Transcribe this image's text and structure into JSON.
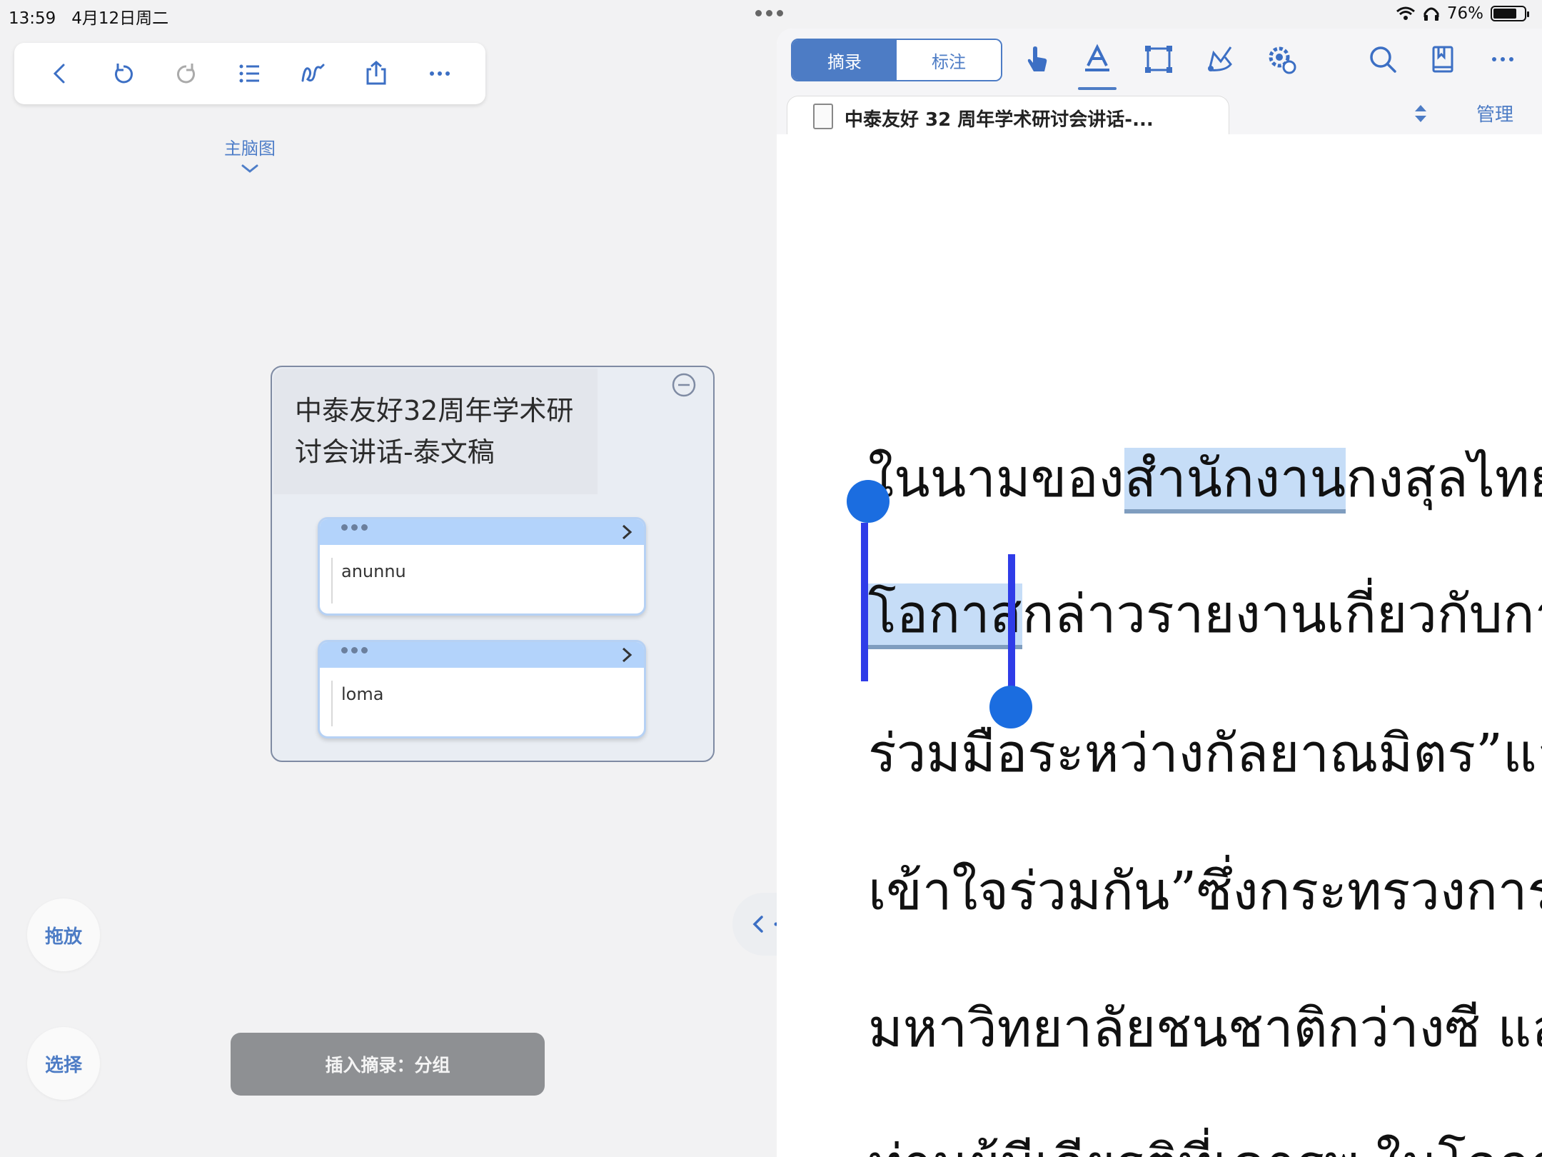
{
  "status_bar": {
    "time": "13:59",
    "date": "4月12日周二",
    "battery": "76%",
    "battery_level": 0.76
  },
  "left_toolbar": {
    "icons": [
      "back-icon",
      "undo-icon",
      "redo-icon",
      "list-icon",
      "draw-icon",
      "share-icon",
      "more-icon"
    ]
  },
  "mindmap": {
    "label": "主脑图",
    "group_title": "中泰友好32周年学术研讨会讲话-泰文稿",
    "cards": [
      {
        "text": "anunnu"
      },
      {
        "text": "loma"
      }
    ]
  },
  "left_buttons": {
    "drag": "拖放",
    "select": "选择",
    "insert": "插入摘录：分组"
  },
  "right_toolbar": {
    "seg_excerpt": "摘录",
    "seg_annotate": "标注",
    "icons": [
      "hand-icon",
      "text-highlight-icon",
      "rectangle-select-icon",
      "lasso-icon",
      "settings-icon",
      "search-icon",
      "bookmark-icon",
      "more-icon"
    ]
  },
  "document": {
    "tab_title": "中泰友好 32 周年学术研讨会讲话-...",
    "manage": "管理",
    "lines": {
      "l1_a": "ในนามของ",
      "l1_hl": "สำนักงาน",
      "l1_b": "กงสุลไทย",
      "l2_hl": "โอกาส",
      "l2_b": "กล่าวรายงานเกี่ยวกับการ",
      "l3": "ร่วมมือระหว่างกัลยาณมิตร”และ",
      "l4": "เข้าใจร่วมกัน”ซึ่งกระทรวงการต",
      "l5": "มหาวิทยาลัยชนชาติกว่างซี และ",
      "l6": "ท่านผู้มีเกียรติที่เคารพ ในโอกาส"
    }
  },
  "colors": {
    "accent": "#4d7cc5",
    "highlight": "#c6ddf7",
    "selection_caret": "#2f3ce8"
  }
}
